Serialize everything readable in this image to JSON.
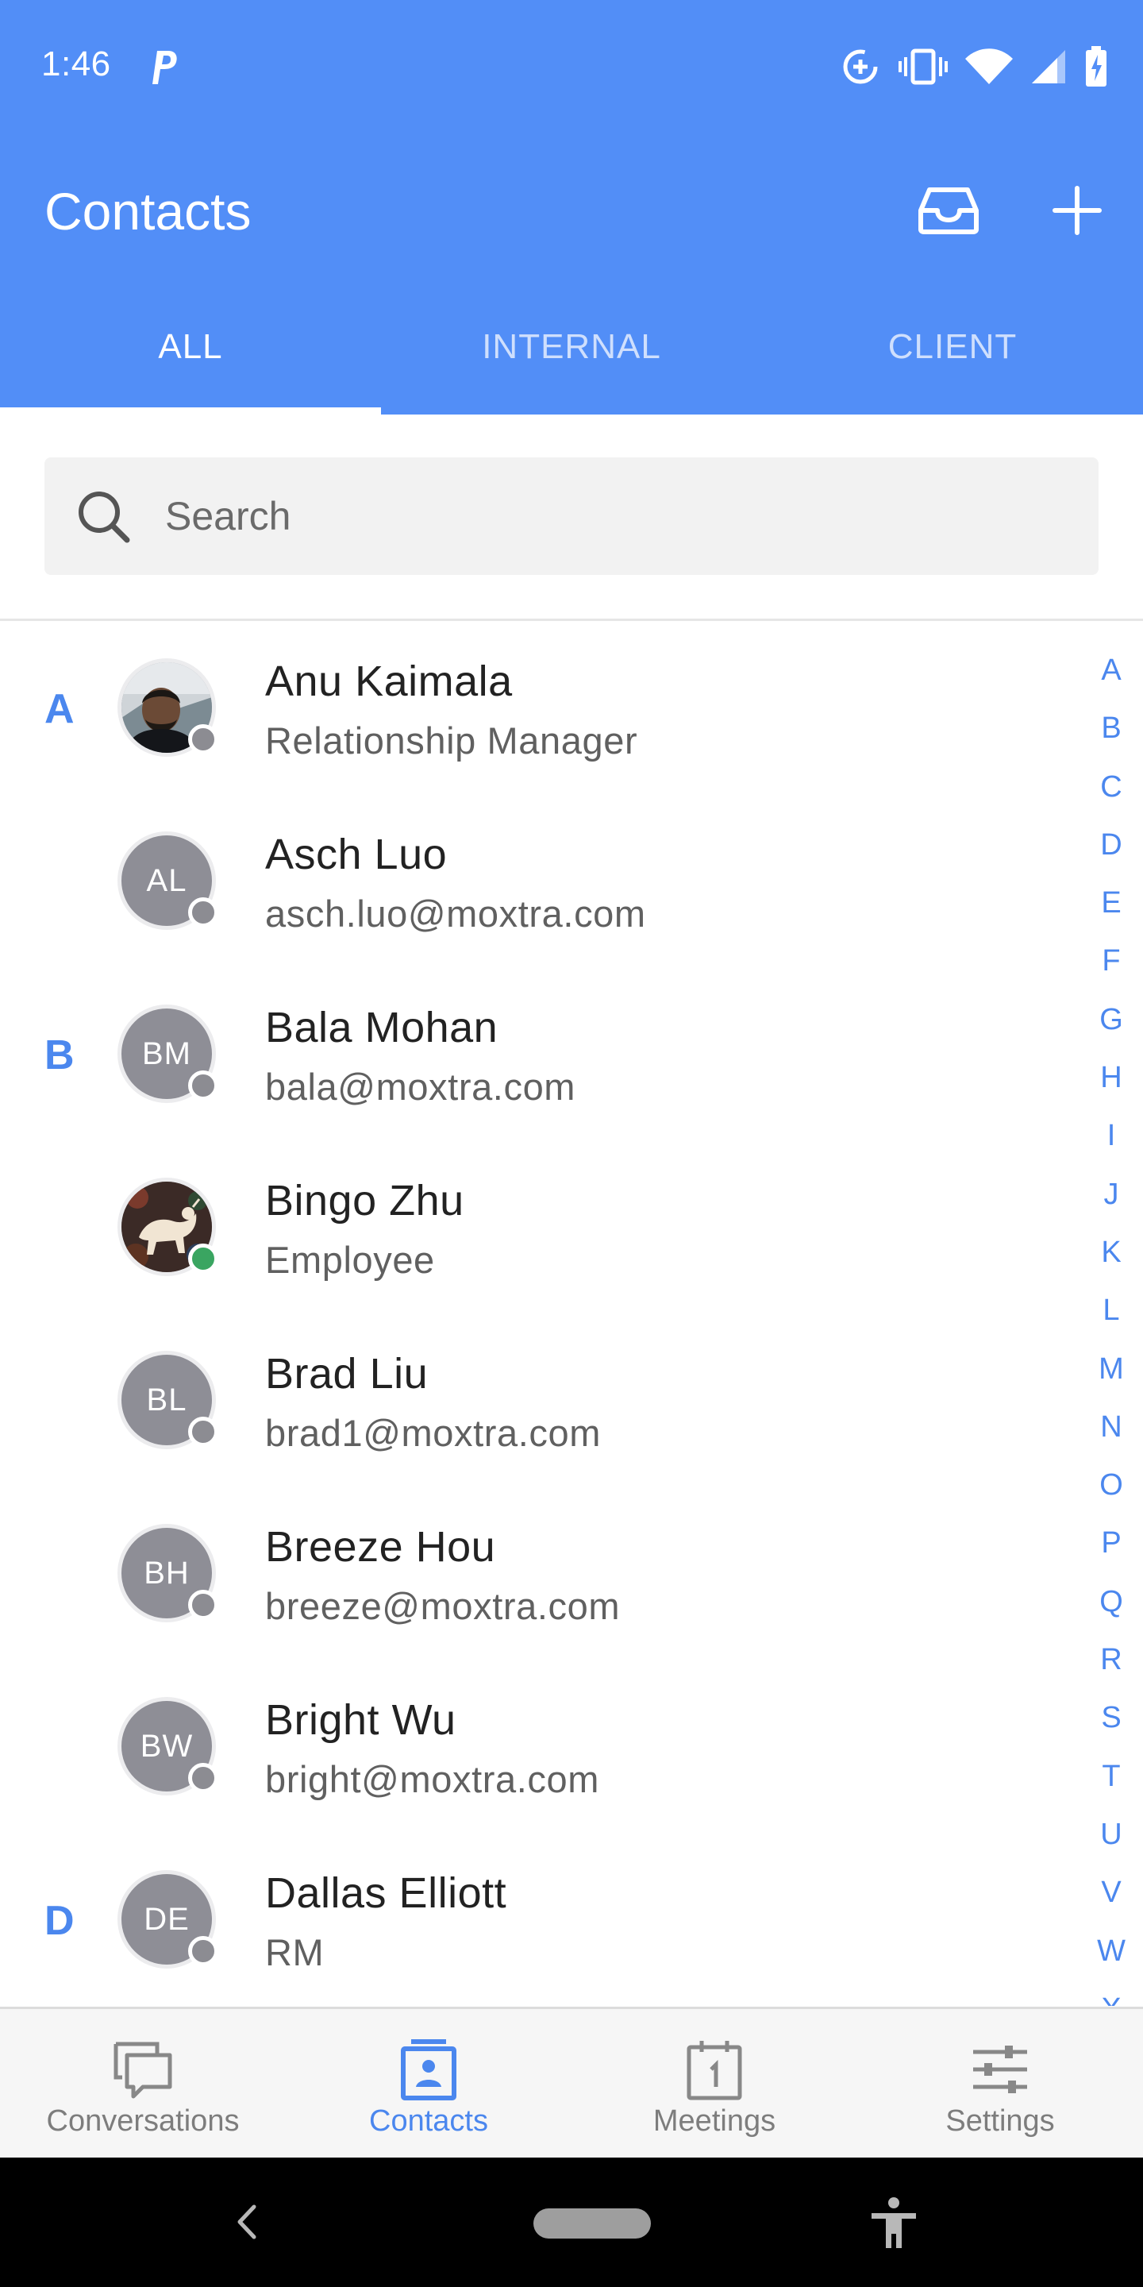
{
  "status_bar": {
    "time": "1:46"
  },
  "header": {
    "title": "Contacts",
    "accent_color": "#528ef7"
  },
  "tabs": [
    {
      "label": "ALL",
      "active": true
    },
    {
      "label": "INTERNAL",
      "active": false
    },
    {
      "label": "CLIENT",
      "active": false
    }
  ],
  "search": {
    "placeholder": "Search",
    "value": ""
  },
  "contacts": [
    {
      "section": "A",
      "name": "Anu Kaimala",
      "subtitle": "Relationship Manager",
      "initials": "",
      "avatar": "photo-man",
      "presence": "offline"
    },
    {
      "section": "",
      "name": "Asch Luo",
      "subtitle": "asch.luo@moxtra.com",
      "initials": "AL",
      "avatar": "initials",
      "presence": "offline"
    },
    {
      "section": "B",
      "name": "Bala Mohan",
      "subtitle": "bala@moxtra.com",
      "initials": "BM",
      "avatar": "initials",
      "presence": "offline"
    },
    {
      "section": "",
      "name": "Bingo Zhu",
      "subtitle": "Employee",
      "initials": "",
      "avatar": "photo-art",
      "presence": "online"
    },
    {
      "section": "",
      "name": "Brad Liu",
      "subtitle": "brad1@moxtra.com",
      "initials": "BL",
      "avatar": "initials",
      "presence": "offline"
    },
    {
      "section": "",
      "name": "Breeze Hou",
      "subtitle": "breeze@moxtra.com",
      "initials": "BH",
      "avatar": "initials",
      "presence": "offline"
    },
    {
      "section": "",
      "name": "Bright Wu",
      "subtitle": "bright@moxtra.com",
      "initials": "BW",
      "avatar": "initials",
      "presence": "offline"
    },
    {
      "section": "D",
      "name": "Dallas Elliott",
      "subtitle": "RM",
      "initials": "DE",
      "avatar": "initials",
      "presence": "offline"
    }
  ],
  "alphabet_index": [
    "A",
    "B",
    "C",
    "D",
    "E",
    "F",
    "G",
    "H",
    "I",
    "J",
    "K",
    "L",
    "M",
    "N",
    "O",
    "P",
    "Q",
    "R",
    "S",
    "T",
    "U",
    "V",
    "W",
    "X"
  ],
  "bottom_nav": [
    {
      "label": "Conversations",
      "icon": "chat-bubbles-icon",
      "active": false
    },
    {
      "label": "Contacts",
      "icon": "contact-card-icon",
      "active": true
    },
    {
      "label": "Meetings",
      "icon": "calendar-icon",
      "active": false
    },
    {
      "label": "Settings",
      "icon": "sliders-icon",
      "active": false
    }
  ]
}
